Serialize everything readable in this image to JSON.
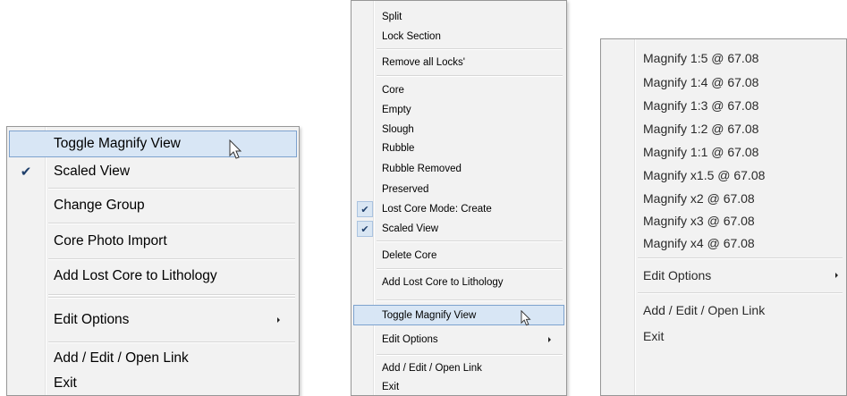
{
  "menu_a": {
    "items": [
      {
        "label": "Toggle Magnify View",
        "highlighted": true
      },
      {
        "label": "Scaled View",
        "checked": true
      },
      {
        "label": "Change Group"
      },
      {
        "label": "Core Photo Import"
      },
      {
        "label": "Add Lost Core to Lithology"
      },
      {
        "label": "Edit Options",
        "submenu": true
      },
      {
        "label": "Add / Edit / Open Link"
      },
      {
        "label": "Exit"
      }
    ]
  },
  "menu_b": {
    "items": [
      {
        "label": "Split"
      },
      {
        "label": "Lock Section"
      },
      {
        "label": "Remove all Locks'"
      },
      {
        "label": "Core"
      },
      {
        "label": "Empty"
      },
      {
        "label": "Slough"
      },
      {
        "label": "Rubble"
      },
      {
        "label": "Rubble Removed"
      },
      {
        "label": "Preserved"
      },
      {
        "label": "Lost Core Mode: Create",
        "checked": true
      },
      {
        "label": "Scaled View",
        "checked": true
      },
      {
        "label": "Delete Core"
      },
      {
        "label": "Add Lost Core to Lithology"
      },
      {
        "label": "Toggle Magnify View",
        "highlighted": true
      },
      {
        "label": "Edit Options",
        "submenu": true
      },
      {
        "label": "Add / Edit / Open Link"
      },
      {
        "label": "Exit"
      }
    ]
  },
  "menu_c": {
    "items": [
      {
        "label": "Magnify 1:5 @ 67.08"
      },
      {
        "label": "Magnify 1:4 @ 67.08"
      },
      {
        "label": "Magnify 1:3 @ 67.08"
      },
      {
        "label": "Magnify 1:2 @ 67.08"
      },
      {
        "label": "Magnify 1:1 @ 67.08"
      },
      {
        "label": "Magnify x1.5 @ 67.08"
      },
      {
        "label": "Magnify x2 @ 67.08"
      },
      {
        "label": "Magnify x3 @ 67.08"
      },
      {
        "label": "Magnify x4 @ 67.08"
      },
      {
        "label": "Edit Options",
        "submenu": true
      },
      {
        "label": "Add / Edit / Open Link"
      },
      {
        "label": "Exit"
      }
    ]
  },
  "icons": {
    "checkmark": "checkmark-icon",
    "submenu_arrow": "submenu-arrow-icon",
    "cursor": "mouse-pointer-icon"
  },
  "colors": {
    "menu_bg": "#f2f2f2",
    "highlight_bg": "#d8e6f5",
    "highlight_border": "#7da2ce",
    "check_color": "#1f3f6b"
  }
}
